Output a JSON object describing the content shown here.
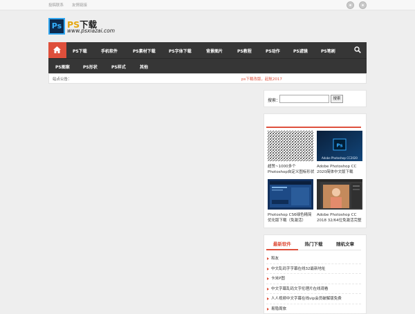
{
  "topbar": {
    "links": [
      "投稿联系",
      "友情链接"
    ],
    "icons": [
      "location-icon",
      "settings-icon"
    ]
  },
  "logo": {
    "mark": "Ps",
    "title_highlight": "PS",
    "title_rest": "下载",
    "domain": "www.psxiazai.com"
  },
  "nav": {
    "home_icon": "home-icon",
    "row1": [
      "PS下载",
      "手机软件",
      "PS素材下载",
      "PS字体下载",
      "背景图片",
      "PS教程",
      "PS动作",
      "PS滤镜",
      "PS笔刷"
    ],
    "row2": [
      "PS图案",
      "PS形状",
      "PS样式",
      "其他"
    ],
    "search_icon": "search-icon"
  },
  "notice": {
    "label": "站点公告：",
    "message": "ps下载改版，起航2017"
  },
  "search": {
    "label": "搜索：",
    "value": "",
    "button": "搜索"
  },
  "featured": {
    "items": [
      {
        "caption": "超赞~1000多个Photoshop自定义图标形状",
        "thumb": "noise-texture"
      },
      {
        "caption": "Adobe Photoshop CC 2020简体中文版下载",
        "thumb": "ps-cc2020",
        "thumb_text": "Adobe Photoshop CC2020"
      },
      {
        "caption": "Photoshop CS6绿色精简优化版下载（免激活）",
        "thumb": "ps-cs6"
      },
      {
        "caption": "Adobe Photoshop CC 2018 32/64位免激活完整版",
        "thumb": "ps-cc2018"
      }
    ]
  },
  "tabs": {
    "labels": [
      "最新软件",
      "热门下载",
      "随机文章"
    ],
    "active": 0
  },
  "latest": {
    "items": [
      "和友",
      "中文乱码字字幕在线32最新地址",
      "卡米P图",
      "中文字幕乱码文字伦理片在线观看",
      "人人视频中文字幕在线vip会员破解版免费",
      "易隐周旅"
    ]
  },
  "colors": {
    "accent": "#de4f3b",
    "nav_bg": "#363636",
    "page_bg": "#eeeeee",
    "ps_blue": "#31a8ff"
  }
}
